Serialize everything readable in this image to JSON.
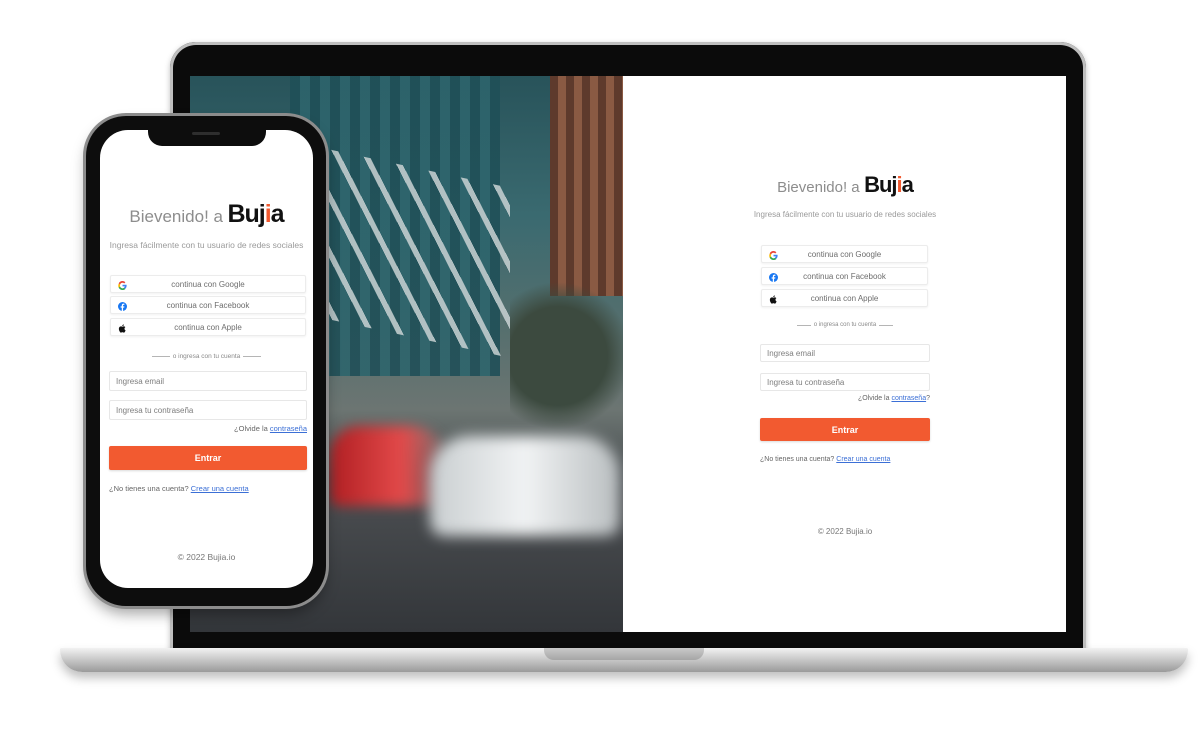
{
  "login": {
    "welcome_prefix": "Bievenido! a",
    "brand_name_part1": "Buj",
    "brand_name_dot": "i",
    "brand_name_part2": "a",
    "subtitle": "Ingresa fácilmente con tu usuario de redes sociales",
    "google_label": "continua con Google",
    "facebook_label": "continua con Facebook",
    "apple_label": "continua con Apple",
    "divider_text": "o ingresa con tu cuenta",
    "email_placeholder": "Ingresa email",
    "password_placeholder": "Ingresa tu contraseña",
    "forgot_prefix": "¿Olvide la",
    "forgot_link": "contraseña",
    "forgot_suffix": "?",
    "submit_label": "Entrar",
    "no_account_text": "¿No tienes una cuenta?",
    "create_account_link": "Crear una cuenta",
    "footer": "© 2022 Bujia.io"
  },
  "colors": {
    "accent": "#f25a30",
    "link": "#3b6fd6"
  },
  "icons": [
    "google-icon",
    "facebook-icon",
    "apple-icon"
  ]
}
